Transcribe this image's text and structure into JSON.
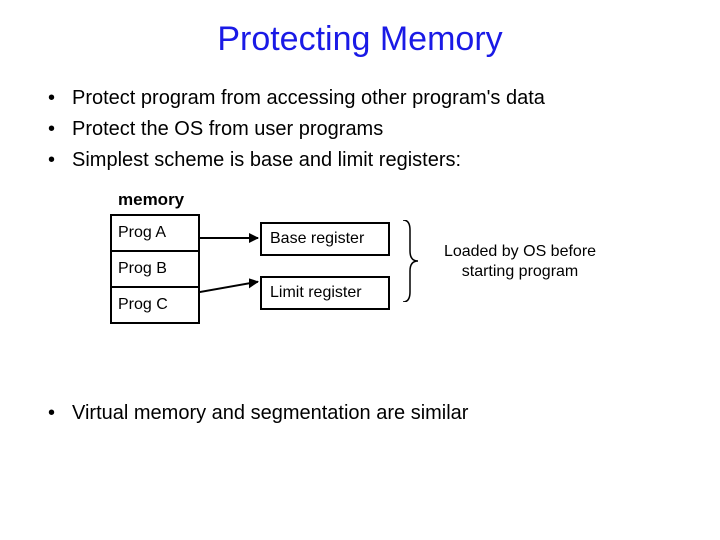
{
  "title": "Protecting Memory",
  "bullets": [
    "Protect program from accessing other program's data",
    "Protect the OS from user programs",
    "Simplest scheme is base and limit registers:"
  ],
  "memory_label": "memory",
  "memory_cells": [
    "Prog A",
    "Prog B",
    "Prog C"
  ],
  "base_register": "Base register",
  "limit_register": "Limit register",
  "loaded_text": "Loaded by OS before starting program",
  "lower_bullet": "Virtual memory and segmentation are similar"
}
